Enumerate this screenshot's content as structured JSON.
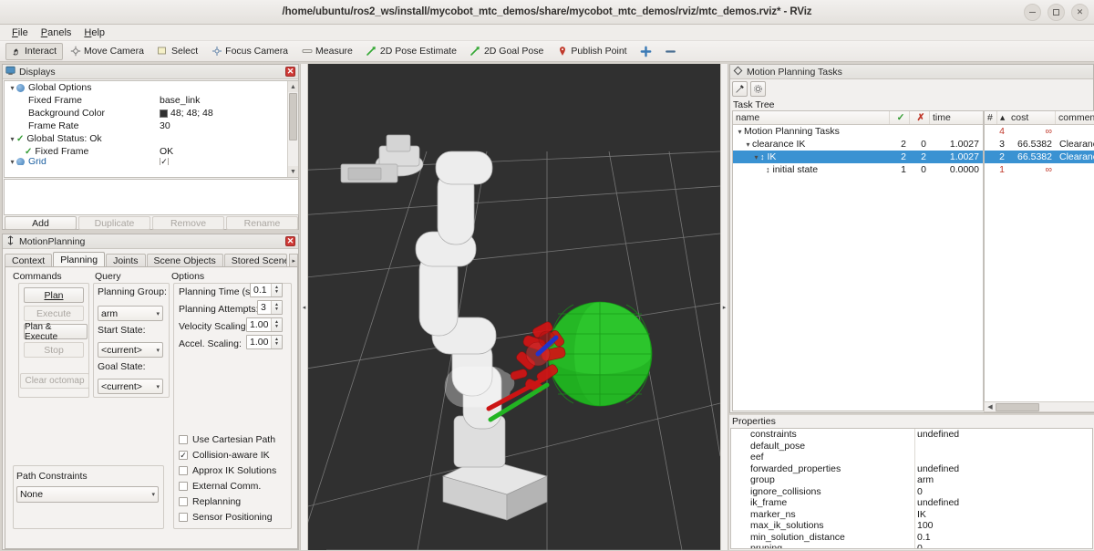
{
  "window": {
    "title": "/home/ubuntu/ros2_ws/install/mycobot_mtc_demos/share/mycobot_mtc_demos/rviz/mtc_demos.rviz* - RViz",
    "minimize_label": "–",
    "maximize_label": "□",
    "close_label": "✕"
  },
  "menubar": {
    "items": [
      "File",
      "Panels",
      "Help"
    ]
  },
  "toolbar": {
    "items": [
      {
        "label": "Interact",
        "icon": "hand-cursor-icon",
        "active": true
      },
      {
        "label": "Move Camera",
        "icon": "move-camera-icon",
        "active": false
      },
      {
        "label": "Select",
        "icon": "select-rect-icon",
        "active": false
      },
      {
        "label": "Focus Camera",
        "icon": "focus-camera-icon",
        "active": false
      },
      {
        "label": "Measure",
        "icon": "measure-icon",
        "active": false
      },
      {
        "label": "2D Pose Estimate",
        "icon": "pose-arrow-icon",
        "active": false
      },
      {
        "label": "2D Goal Pose",
        "icon": "goal-arrow-icon",
        "active": false
      },
      {
        "label": "Publish Point",
        "icon": "map-pin-icon",
        "active": false
      },
      {
        "label": "",
        "icon": "plus-tool-icon",
        "active": false
      },
      {
        "label": "",
        "icon": "minus-tool-icon",
        "active": false
      }
    ]
  },
  "displays": {
    "title": "Displays",
    "close_label": "✕",
    "tree": [
      {
        "indent": 0,
        "expander": "▾",
        "icon": "global-options-icon",
        "label": "Global Options",
        "value": "",
        "value_kind": "none"
      },
      {
        "indent": 1,
        "expander": "",
        "icon": "",
        "label": "Fixed Frame",
        "value": "base_link",
        "value_kind": "text"
      },
      {
        "indent": 1,
        "expander": "",
        "icon": "",
        "label": "Background Color",
        "value": "48; 48; 48",
        "value_kind": "color",
        "color": "#303030"
      },
      {
        "indent": 1,
        "expander": "",
        "icon": "",
        "label": "Frame Rate",
        "value": "30",
        "value_kind": "text"
      },
      {
        "indent": 0,
        "expander": "▾",
        "icon": "status-ok-icon",
        "label": "Global Status: Ok",
        "value": "",
        "value_kind": "none"
      },
      {
        "indent": 1,
        "expander": "",
        "icon": "status-ok-icon",
        "label": "Fixed Frame",
        "value": "OK",
        "value_kind": "text"
      },
      {
        "indent": 0,
        "expander": "▸",
        "icon": "grid-icon",
        "label": "Grid",
        "value": "",
        "value_kind": "checkbox"
      }
    ],
    "buttons": [
      {
        "label": "Add",
        "enabled": true
      },
      {
        "label": "Duplicate",
        "enabled": false
      },
      {
        "label": "Remove",
        "enabled": false
      },
      {
        "label": "Rename",
        "enabled": false
      }
    ]
  },
  "motion_planning": {
    "title": "MotionPlanning",
    "close_label": "✕",
    "tabs": [
      {
        "label": "Context",
        "selected": false
      },
      {
        "label": "Planning",
        "selected": true
      },
      {
        "label": "Joints",
        "selected": false
      },
      {
        "label": "Scene Objects",
        "selected": false
      },
      {
        "label": "Stored Scene",
        "selected": false
      }
    ],
    "tab_scroll_right": "▸",
    "groups": {
      "commands": "Commands",
      "query": "Query",
      "options": "Options"
    },
    "commands": [
      {
        "label": "Plan",
        "enabled": true
      },
      {
        "label": "Execute",
        "enabled": false
      },
      {
        "label": "Plan & Execute",
        "enabled": true
      },
      {
        "label": "Stop",
        "enabled": false
      },
      {
        "label": "Clear octomap",
        "enabled": false
      }
    ],
    "query": {
      "planning_group_label": "Planning Group:",
      "planning_group_value": "arm",
      "start_state_label": "Start State:",
      "start_state_value": "<current>",
      "goal_state_label": "Goal State:",
      "goal_state_value": "<current>"
    },
    "options": {
      "planning_time_label": "Planning Time (s):",
      "planning_time_value": "0.1",
      "planning_attempts_label": "Planning Attempts:",
      "planning_attempts_value": "3",
      "velocity_scaling_label": "Velocity Scaling:",
      "velocity_scaling_value": "1.00",
      "accel_scaling_label": "Accel. Scaling:",
      "accel_scaling_value": "1.00",
      "checkboxes": [
        {
          "label": "Use Cartesian Path",
          "checked": false
        },
        {
          "label": "Collision-aware IK",
          "checked": true
        },
        {
          "label": "Approx IK Solutions",
          "checked": false
        },
        {
          "label": "External Comm.",
          "checked": false
        },
        {
          "label": "Replanning",
          "checked": false
        },
        {
          "label": "Sensor Positioning",
          "checked": false
        }
      ]
    },
    "path_constraints_label": "Path Constraints",
    "path_constraints_value": "None"
  },
  "tasks_panel": {
    "title": "Motion Planning Tasks",
    "task_tree_label": "Task Tree",
    "tools": [
      "exec-task-icon",
      "settings-gear-icon"
    ],
    "left_columns": [
      "name",
      "✓",
      "✗",
      "time"
    ],
    "right_columns": [
      "#",
      "▴",
      "cost",
      "comment"
    ],
    "rows": [
      {
        "indent": 0,
        "expander": "▾",
        "icon": "",
        "name": "Motion Planning Tasks",
        "success": "",
        "failure": "",
        "time": "",
        "num": "4",
        "cost": "∞",
        "comment": "",
        "selected": false,
        "red": true
      },
      {
        "indent": 1,
        "expander": "▾",
        "icon": "",
        "name": "clearance IK",
        "success": "2",
        "failure": "0",
        "time": "1.0027",
        "num": "3",
        "cost": "66.5382",
        "comment": "Clearance: d",
        "selected": false,
        "red": false
      },
      {
        "indent": 2,
        "expander": "▾",
        "icon": "updown-arrow-icon",
        "name": "IK",
        "success": "2",
        "failure": "2",
        "time": "1.0027",
        "num": "2",
        "cost": "66.5382",
        "comment": "Clearance: d",
        "selected": true,
        "red": false
      },
      {
        "indent": 3,
        "expander": "",
        "icon": "updown-arrow-icon",
        "name": "initial state",
        "success": "1",
        "failure": "0",
        "time": "0.0000",
        "num": "1",
        "cost": "∞",
        "comment": "",
        "selected": false,
        "red": true
      }
    ]
  },
  "properties": {
    "title": "Properties",
    "rows": [
      {
        "key": "constraints",
        "value": "undefined"
      },
      {
        "key": "default_pose",
        "value": ""
      },
      {
        "key": "eef",
        "value": ""
      },
      {
        "key": "forwarded_properties",
        "value": "undefined"
      },
      {
        "key": "group",
        "value": "arm"
      },
      {
        "key": "ignore_collisions",
        "value": "0"
      },
      {
        "key": "ik_frame",
        "value": "undefined"
      },
      {
        "key": "marker_ns",
        "value": "IK"
      },
      {
        "key": "max_ik_solutions",
        "value": "100"
      },
      {
        "key": "min_solution_distance",
        "value": "0.1"
      },
      {
        "key": "pruning",
        "value": "0"
      }
    ]
  },
  "viewport": {
    "background_color": "#303030",
    "grid_color": "#9a9a9a",
    "robot_color": "#e8e8e8",
    "sphere_color": "#22c022",
    "marker_color": "#d01414",
    "left_grabber": "◂",
    "right_grabber": "▸"
  }
}
